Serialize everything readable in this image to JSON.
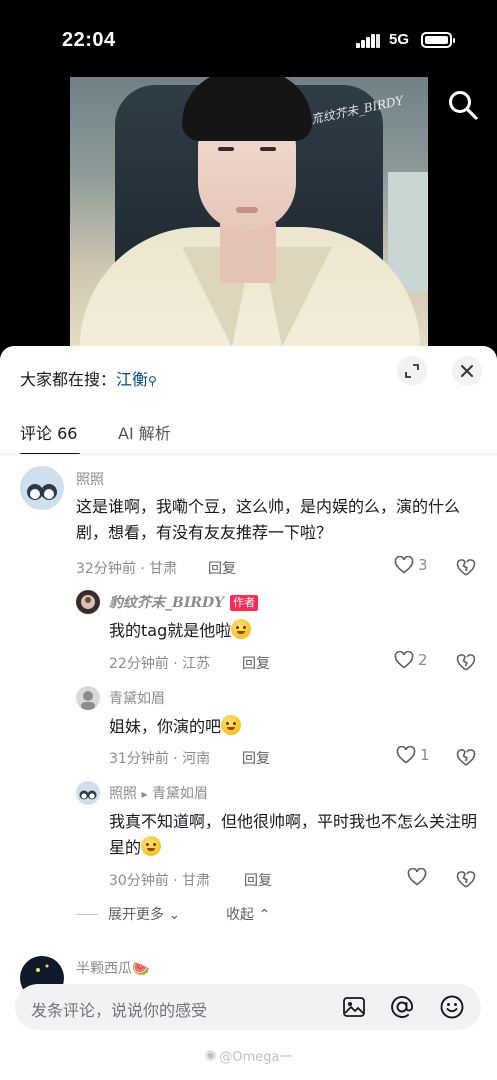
{
  "status_bar": {
    "time": "22:04",
    "network": "5G"
  },
  "video": {
    "watermark": "㐬纹芥未_BIRDY"
  },
  "sheet": {
    "trending_label": "大家都在搜：",
    "trending_keyword": "江衡",
    "tabs": [
      {
        "label": "评论 66"
      },
      {
        "label": "AI 解析"
      }
    ]
  },
  "comments": [
    {
      "username": "照照",
      "text": "这是谁啊，我嘞个豆，这么帅，是内娱的么，演的什么剧，想看，有没有友友推荐一下啦？",
      "meta": "32分钟前 · 甘肃",
      "reply_label": "回复",
      "likes": "3"
    },
    {
      "username": "豹纹芥末_BIRDY",
      "badge": "作者",
      "text": "我的tag就是他啦",
      "meta": "22分钟前 · 江苏",
      "reply_label": "回复",
      "likes": "2"
    },
    {
      "username": "青黛如眉",
      "text": "姐妹，你演的吧",
      "meta": "31分钟前 · 河南",
      "reply_label": "回复",
      "likes": "1"
    },
    {
      "username": "照照",
      "reply_to_arrow": "▸",
      "reply_to": "青黛如眉",
      "text": "我真不知道啊，但他很帅啊，平时我也不怎么关注明星的",
      "meta": "30分钟前 · 甘肃",
      "reply_label": "回复",
      "likes": ""
    },
    {
      "username": "半颗西瓜🍉"
    }
  ],
  "thread_controls": {
    "expand_more": "展开更多",
    "collapse": "收起"
  },
  "input_bar": {
    "placeholder": "发条评论，说说你的感受"
  },
  "footer_watermark": "@Omega一",
  "colors": {
    "accent_red": "#fe2c55",
    "link_blue": "#04498d",
    "text": "#161823",
    "muted": "#8a8b91"
  }
}
